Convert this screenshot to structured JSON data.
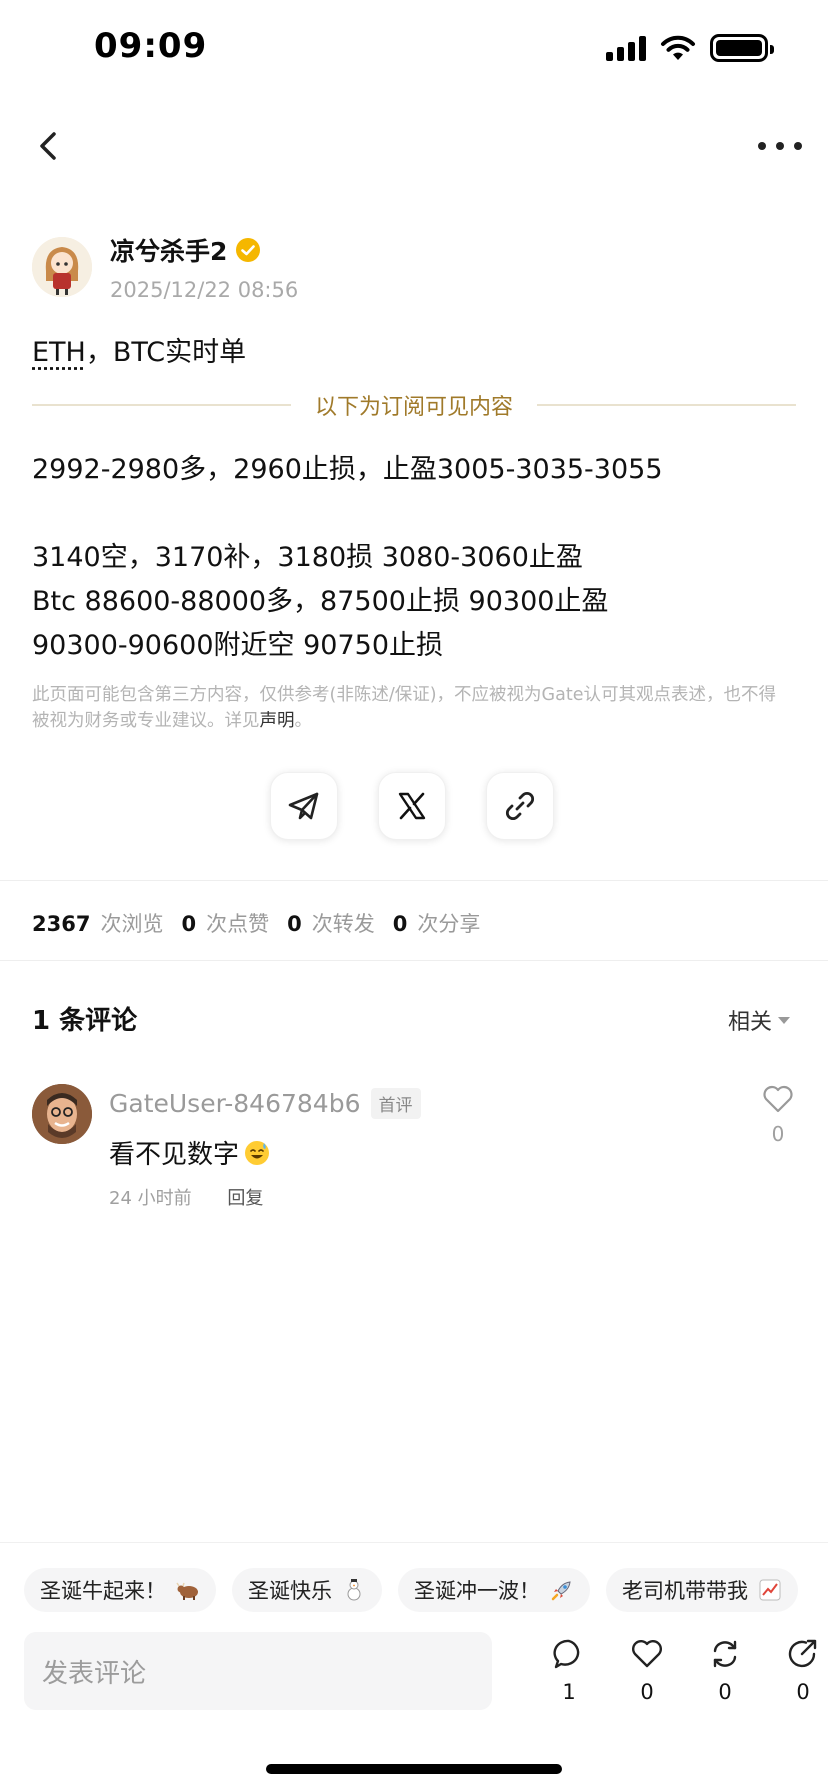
{
  "status": {
    "time": "09:09"
  },
  "author": {
    "name": "凉兮杀手2",
    "timestamp": "2025/12/22 08:56"
  },
  "post": {
    "title_part1": "ETH",
    "title_part2": "，BTC实时单",
    "subscribe_divider": "以下为订阅可见内容",
    "lines": [
      "2992-2980多，2960止损，止盈3005-3035-3055",
      "3140空，3170补，3180损 3080-3060止盈",
      "Btc 88600-88000多，87500止损 90300止盈",
      "90300-90600附近空 90750止损"
    ],
    "disclaimer": "此页面可能包含第三方内容，仅供参考(非陈述/保证)，不应被视为Gate认可其观点表述，也不得被视为财务或专业建议。详见",
    "disclaimer_link": "声明",
    "disclaimer_end": "。"
  },
  "share": {
    "icons": [
      "telegram-icon",
      "x-icon",
      "link-icon"
    ]
  },
  "stats": [
    {
      "num": "2367",
      "label": "次浏览"
    },
    {
      "num": "0",
      "label": "次点赞"
    },
    {
      "num": "0",
      "label": "次转发"
    },
    {
      "num": "0",
      "label": "次分享"
    }
  ],
  "comments": {
    "title": "1 条评论",
    "sort": "相关",
    "items": [
      {
        "user": "GateUser-846784b6",
        "badge": "首评",
        "text": "看不见数字",
        "emoji": "sweat-smile-emoji",
        "time": "24 小时前",
        "reply": "回复",
        "likes": "0"
      }
    ]
  },
  "chips": [
    {
      "label": "圣诞牛起来！",
      "icon": "ox-icon"
    },
    {
      "label": "圣诞快乐",
      "icon": "snowman-icon"
    },
    {
      "label": "圣诞冲一波！",
      "icon": "rocket-icon"
    },
    {
      "label": "老司机带带我",
      "icon": "chart-up-icon"
    }
  ],
  "composer": {
    "placeholder": "发表评论"
  },
  "actions": [
    {
      "icon": "comment-icon",
      "count": "1"
    },
    {
      "icon": "heart-icon",
      "count": "0"
    },
    {
      "icon": "repost-icon",
      "count": "0"
    },
    {
      "icon": "share-icon",
      "count": "0"
    }
  ],
  "colors": {
    "gold": "#a07a2a",
    "verified": "#f5b700"
  }
}
